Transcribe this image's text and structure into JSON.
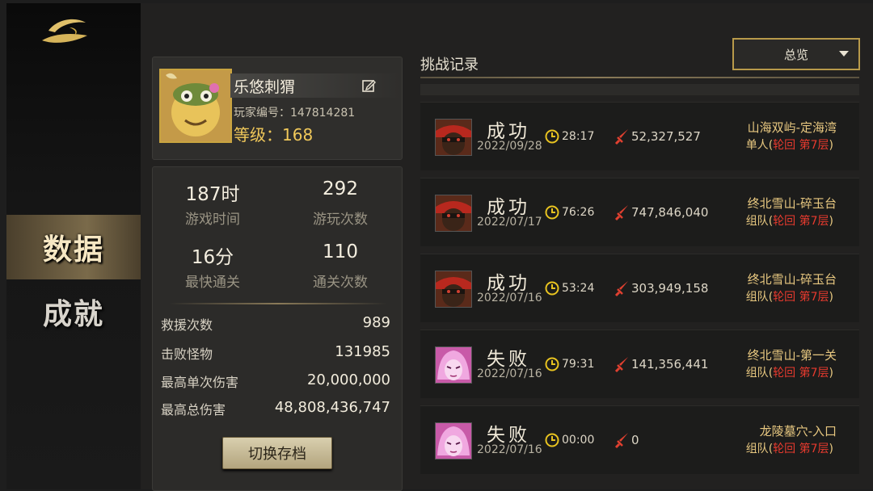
{
  "sidebar": {
    "items": [
      {
        "label": "数据"
      },
      {
        "label": "成就"
      }
    ]
  },
  "profile": {
    "name": "乐悠刺猬",
    "id_label": "玩家编号：",
    "id_value": "147814281",
    "level_label": "等级：",
    "level_value": "168"
  },
  "stats": {
    "grid": [
      {
        "value": "187时",
        "label": "游戏时间"
      },
      {
        "value": "292",
        "label": "游玩次数"
      },
      {
        "value": "16分",
        "label": "最快通关"
      },
      {
        "value": "110",
        "label": "通关次数"
      }
    ],
    "rows": [
      {
        "label": "救援次数",
        "value": "989"
      },
      {
        "label": "击败怪物",
        "value": "131985"
      },
      {
        "label": "最高单次伤害",
        "value": "20,000,000"
      },
      {
        "label": "最高总伤害",
        "value": "48,808,436,747"
      }
    ],
    "switch_label": "切换存档"
  },
  "records": {
    "title": "挑战记录",
    "filter": "总览",
    "items": [
      {
        "result": "成功",
        "date": "2022/09/28",
        "time": "28:17",
        "damage": "52,327,527",
        "location": "山海双屿-定海湾",
        "mode": "单人",
        "paren_open": "(",
        "round": "轮回",
        "floor": "第7层",
        "paren_close": ")",
        "avatar": "warrior"
      },
      {
        "result": "成功",
        "date": "2022/07/17",
        "time": "76:26",
        "damage": "747,846,040",
        "location": "终北雪山-碎玉台",
        "mode": "组队",
        "paren_open": "(",
        "round": "轮回",
        "floor": "第7层",
        "paren_close": ")",
        "avatar": "warrior"
      },
      {
        "result": "成功",
        "date": "2022/07/16",
        "time": "53:24",
        "damage": "303,949,158",
        "location": "终北雪山-碎玉台",
        "mode": "组队",
        "paren_open": "(",
        "round": "轮回",
        "floor": "第7层",
        "paren_close": ")",
        "avatar": "warrior"
      },
      {
        "result": "失败",
        "date": "2022/07/16",
        "time": "79:31",
        "damage": "141,356,441",
        "location": "终北雪山-第一关",
        "mode": "组队",
        "paren_open": "(",
        "round": "轮回",
        "floor": "第7层",
        "paren_close": ")",
        "avatar": "pink"
      },
      {
        "result": "失败",
        "date": "2022/07/16",
        "time": "00:00",
        "damage": "0",
        "location": "龙陵墓穴-入口",
        "mode": "组队",
        "paren_open": "(",
        "round": "轮回",
        "floor": "第7层",
        "paren_close": ")",
        "avatar": "pink"
      }
    ]
  },
  "colors": {
    "accent_gold": "#c9a440",
    "red_text": "#e63a2e",
    "location_text": "#e8c880"
  },
  "icons": [
    "logo-icon",
    "edit-icon",
    "clock-icon",
    "sword-icon",
    "chevron-down-icon"
  ]
}
